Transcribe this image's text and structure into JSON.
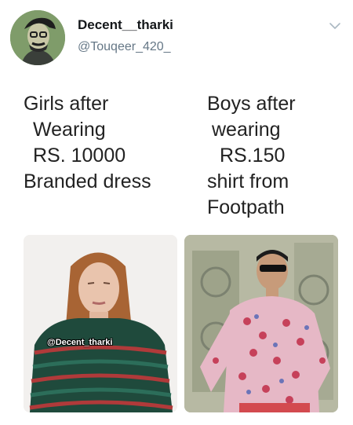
{
  "tweet": {
    "author": {
      "display_name": "Decent__tharki",
      "handle": "@Touqeer_420_",
      "avatar_icon": "cartoon-avatar"
    },
    "menu_icon": "chevron-down-icon",
    "caption_left": [
      "Girls after",
      "Wearing",
      "RS. 10000",
      "Branded dress"
    ],
    "caption_right": [
      "Boys after",
      "wearing",
      "RS.150",
      "shirt from",
      "Footpath"
    ],
    "images": {
      "left": {
        "subject": "girl-in-striped-sweater",
        "watermark": "@Decent_tharki"
      },
      "right": {
        "subject": "man-in-floral-shirt"
      }
    }
  },
  "colors": {
    "name": "#14171a",
    "handle": "#657786",
    "chevron": "#aab8c2"
  }
}
